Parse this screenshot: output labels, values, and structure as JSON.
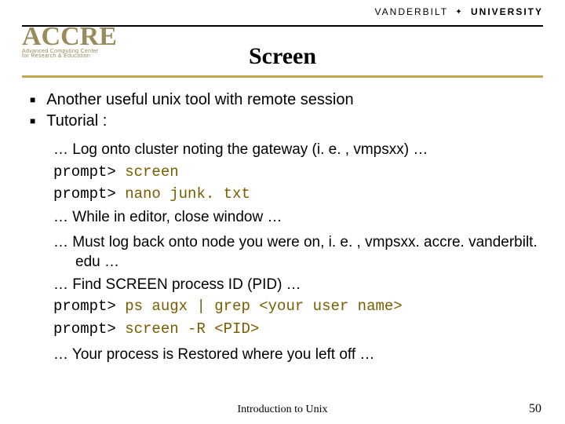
{
  "header": {
    "brand_part1": "VANDERBILT",
    "brand_part2": "UNIVERSITY",
    "logo_main": "ACCRE",
    "logo_sub1": "Advanced Computing Center",
    "logo_sub2": "for Research & Education"
  },
  "title": "Screen",
  "bullets": [
    "Another useful unix tool with remote session",
    "Tutorial :"
  ],
  "block1": {
    "line1": "… Log onto cluster noting the gateway (i. e. , vmpsxx) …",
    "prompt1_p": "prompt>",
    "prompt1_c": " screen",
    "prompt2_p": "prompt>",
    "prompt2_c": " nano junk. txt",
    "line4": "… While in editor, close window …"
  },
  "block2": {
    "line1": "… Must log back onto node you were on, i. e. , vmpsxx. accre. vanderbilt. edu …",
    "line2": "… Find SCREEN process ID (PID) …",
    "prompt1_p": "prompt>",
    "prompt1_c": " ps augx | grep <your user name>",
    "prompt2_p": "prompt>",
    "prompt2_c": " screen -R <PID>"
  },
  "closing": "… Your process is Restored where you left off …",
  "footer": {
    "title": "Introduction to Unix",
    "page": "50"
  }
}
